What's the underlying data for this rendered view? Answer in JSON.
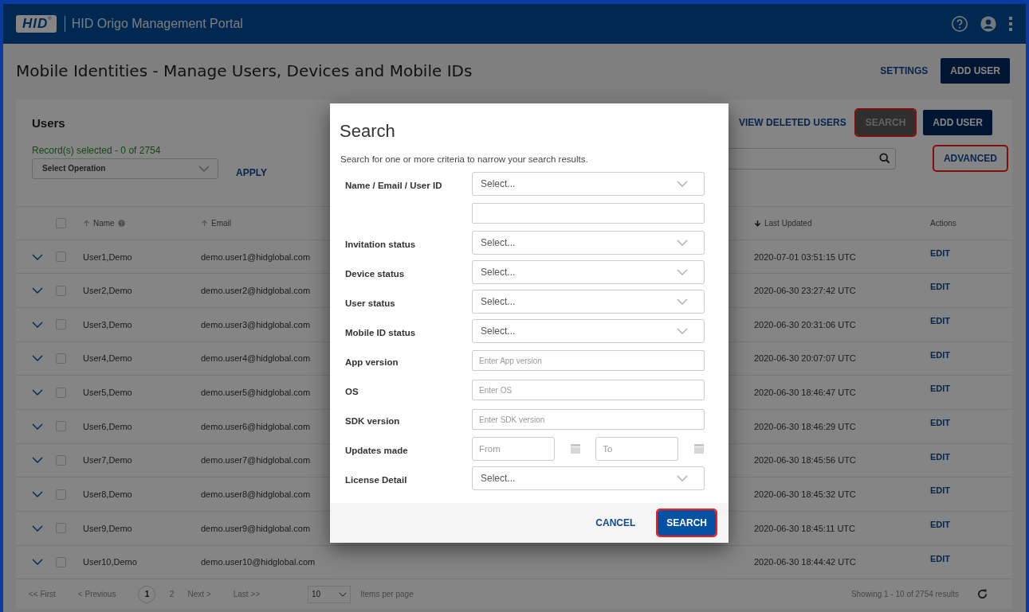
{
  "header": {
    "logo": "HID",
    "logo_mark": "®",
    "title": "HID Origo Management Portal"
  },
  "page": {
    "title": "Mobile Identities - Manage Users, Devices and Mobile IDs",
    "settings_link": "SETTINGS",
    "add_user_button": "ADD USER"
  },
  "users_card": {
    "title": "Users",
    "view_deleted_link": "VIEW DELETED USERS",
    "buttons": [
      {
        "label": "SEARCH",
        "kind": "secondary",
        "highlighted": true
      },
      {
        "label": "ADD USER",
        "kind": "primary",
        "highlighted": false
      }
    ],
    "records_selected": "Record(s) selected -  0 of  2754",
    "operation_select": {
      "placeholder": "Select Operation"
    },
    "apply_link": "APPLY",
    "advanced_link": {
      "label": "ADVANCED",
      "highlighted": true
    },
    "table": {
      "select_all_checked": false,
      "columns": [
        {
          "label": "Name",
          "sort_arrow": true,
          "sort_descending": false,
          "help": true
        },
        {
          "label": "Email",
          "sort_arrow": true,
          "sort_descending": false,
          "help": false
        },
        {
          "label": "Last Updated",
          "sort_arrow": true,
          "sort_descending": true,
          "help": false
        },
        {
          "label": "Actions",
          "sort_arrow": false,
          "help": false
        }
      ],
      "rows": [
        {
          "name": "User1,Demo",
          "email": "demo.user1@hidglobal.com",
          "last_updated": "2020-07-01 03:51:15 UTC",
          "action": "EDIT",
          "checked": false
        },
        {
          "name": "User2,Demo",
          "email": "demo.user2@hidglobal.com",
          "last_updated": "2020-06-30 23:27:42 UTC",
          "action": "EDIT",
          "checked": false
        },
        {
          "name": "User3,Demo",
          "email": "demo.user3@hidglobal.com",
          "last_updated": "2020-06-30 20:31:06 UTC",
          "action": "EDIT",
          "checked": false
        },
        {
          "name": "User4,Demo",
          "email": "demo.user4@hidglobal.com",
          "last_updated": "2020-06-30 20:07:07 UTC",
          "action": "EDIT",
          "checked": false
        },
        {
          "name": "User5,Demo",
          "email": "demo.user5@hidglobal.com",
          "last_updated": "2020-06-30 18:46:47 UTC",
          "action": "EDIT",
          "checked": false
        },
        {
          "name": "User6,Demo",
          "email": "demo.user6@hidglobal.com",
          "last_updated": "2020-06-30 18:46:29 UTC",
          "action": "EDIT",
          "checked": false
        },
        {
          "name": "User7,Demo",
          "email": "demo.user7@hidglobal.com",
          "last_updated": "2020-06-30 18:45:56 UTC",
          "action": "EDIT",
          "checked": false
        },
        {
          "name": "User8,Demo",
          "email": "demo.user8@hidglobal.com",
          "last_updated": "2020-06-30 18:45:32 UTC",
          "action": "EDIT",
          "checked": false
        },
        {
          "name": "User9,Demo",
          "email": "demo.user9@hidglobal.com",
          "last_updated": "2020-06-30 18:45:11 UTC",
          "action": "EDIT",
          "checked": false
        },
        {
          "name": "User10,Demo",
          "email": "demo.user10@hidglobal.com",
          "last_updated": "2020-06-30 18:44:42 UTC",
          "action": "EDIT",
          "checked": false
        }
      ]
    },
    "pagination": {
      "first": "<< First",
      "previous": "< Previous",
      "pages": [
        {
          "label": "1",
          "selected": true
        },
        {
          "label": "2",
          "selected": false
        }
      ],
      "next": "Next >",
      "last": "Last >>",
      "per_page": "10",
      "per_page_label": "Items per page",
      "showing": "Showing 1 - 10 of 2754 results"
    }
  },
  "search_dialog": {
    "title": "Search",
    "description": "Search for one or more criteria to narrow your search results.",
    "fields": [
      {
        "label": "Name / Email / User ID",
        "kind": "select",
        "placeholder": "Select..."
      },
      {
        "kind": "text"
      },
      {
        "label": "Invitation status",
        "kind": "select",
        "placeholder": "Select..."
      },
      {
        "label": "Device status",
        "kind": "select",
        "placeholder": "Select..."
      },
      {
        "label": "User status",
        "kind": "select",
        "placeholder": "Select..."
      },
      {
        "label": "Mobile ID status",
        "kind": "select",
        "placeholder": "Select..."
      },
      {
        "label": "App version",
        "kind": "text",
        "placeholder": "Enter App version"
      },
      {
        "label": "OS",
        "kind": "text",
        "placeholder": "Enter OS"
      },
      {
        "label": "SDK version",
        "kind": "text",
        "placeholder": "Enter SDK version"
      },
      {
        "label": "Updates made",
        "kind": "date-range",
        "from_placeholder": "From",
        "to_placeholder": "To"
      },
      {
        "label": "License Detail",
        "kind": "select",
        "placeholder": "Select..."
      }
    ],
    "cancel_button": "CANCEL",
    "search_button": {
      "label": "SEARCH",
      "highlighted": true
    }
  }
}
